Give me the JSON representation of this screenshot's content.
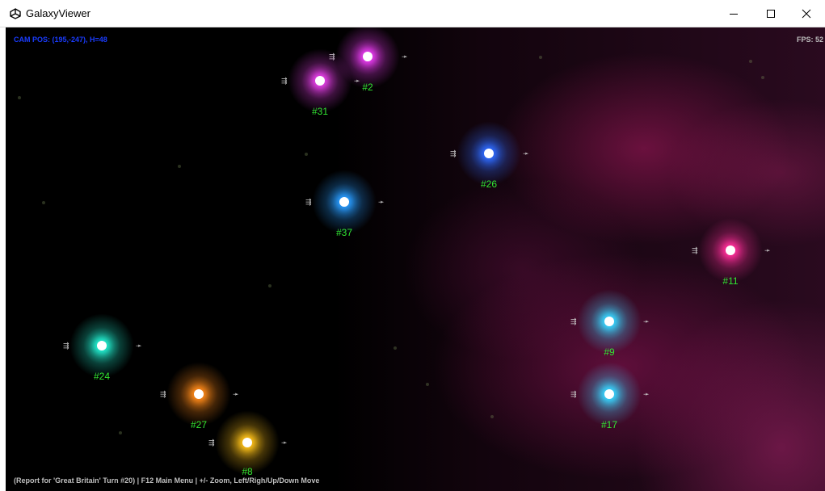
{
  "window": {
    "title": "GalaxyViewer",
    "controls": [
      "minimize",
      "maximize",
      "close"
    ]
  },
  "hud": {
    "cam_pos": "CAM POS: (195,-247), H=48",
    "fps": "FPS: 52",
    "help": "(Report for 'Great Britain' Turn #20) | F12 Main Menu | +/- Zoom, Left/Righ/Up/Down Move"
  },
  "systems": [
    {
      "id": "#2",
      "color": "#e83cf0"
    },
    {
      "id": "#31",
      "color": "#e640e8"
    },
    {
      "id": "#26",
      "color": "#2f6bff"
    },
    {
      "id": "#37",
      "color": "#2a9cff"
    },
    {
      "id": "#11",
      "color": "#ff2f9a"
    },
    {
      "id": "#9",
      "color": "#38d6ff"
    },
    {
      "id": "#17",
      "color": "#38d6ff"
    },
    {
      "id": "#24",
      "color": "#24f0d2"
    },
    {
      "id": "#27",
      "color": "#ff8a1a"
    },
    {
      "id": "#8",
      "color": "#ffc21a"
    }
  ],
  "fleet_icon": "fleet-arrow-icon"
}
